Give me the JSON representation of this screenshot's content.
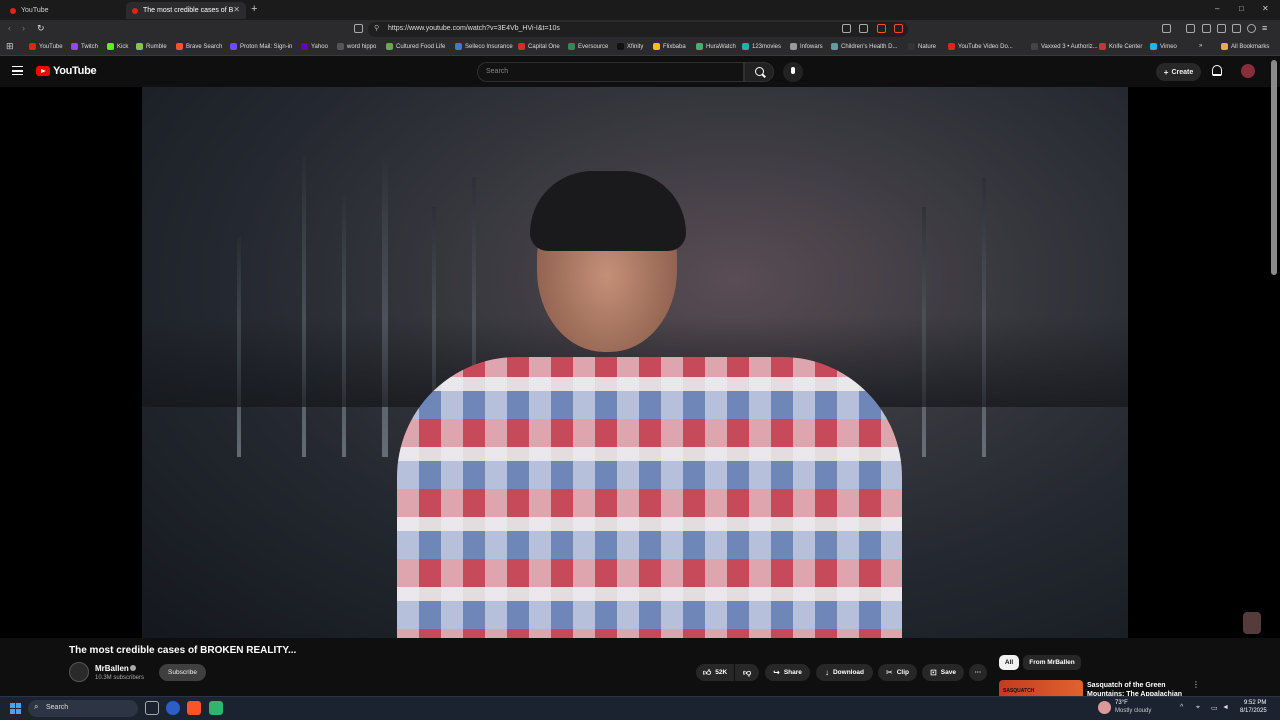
{
  "browser": {
    "tabs": [
      {
        "label": "YouTube",
        "active": false
      },
      {
        "label": "The most credible cases of B",
        "active": true
      }
    ],
    "new_tab": "+",
    "window_controls": [
      "–",
      "□",
      "✕"
    ],
    "url": "https://www.youtube.com/watch?v=3E4Vb_HVi-I&t=10s",
    "bookmarks": [
      {
        "label": "YouTube",
        "color": "#e62117"
      },
      {
        "label": "Twitch",
        "color": "#9146ff"
      },
      {
        "label": "Kick",
        "color": "#53fc18"
      },
      {
        "label": "Rumble",
        "color": "#85c742"
      },
      {
        "label": "Brave Search",
        "color": "#fb542b"
      },
      {
        "label": "Proton Mail: Sign-in",
        "color": "#6d4aff"
      },
      {
        "label": "Yahoo",
        "color": "#6001d2"
      },
      {
        "label": "word hippo",
        "color": "#555555"
      },
      {
        "label": "Cultured Food Life",
        "color": "#6aa84f"
      },
      {
        "label": "Selleco Insurance",
        "color": "#3a7bd5"
      },
      {
        "label": "Capital One",
        "color": "#d03027"
      },
      {
        "label": "Eversource",
        "color": "#2e8b57"
      },
      {
        "label": "Xfinity",
        "color": "#111111"
      },
      {
        "label": "Flixbaba",
        "color": "#f4c20d"
      },
      {
        "label": "HuraWatch",
        "color": "#3cb371"
      },
      {
        "label": "123movies",
        "color": "#20b2aa"
      },
      {
        "label": "Infowars",
        "color": "#999999"
      },
      {
        "label": "Children's Health D...",
        "color": "#5f9ea0"
      },
      {
        "label": "Nature",
        "color": "#333333"
      },
      {
        "label": "YouTube Video Do...",
        "color": "#e62117"
      },
      {
        "label": "Vaxxed 3 • Authoriz...",
        "color": "#444444"
      },
      {
        "label": "Knife Center",
        "color": "#cc3333"
      },
      {
        "label": "Vimeo",
        "color": "#1ab7ea"
      }
    ],
    "more_bookmarks": "»",
    "all_bookmarks": "All Bookmarks"
  },
  "masthead": {
    "logo_text": "YouTube",
    "search_placeholder": "Search",
    "create_label": "Create"
  },
  "video": {
    "title": "The most credible cases of BROKEN REALITY...",
    "channel_name": "MrBallen",
    "subscribers": "10.3M subscribers",
    "subscribe_label": "Subscribe",
    "likes": "52K",
    "share_label": "Share",
    "download_label": "Download",
    "clip_label": "Clip",
    "save_label": "Save",
    "more_label": "···"
  },
  "recommendations": {
    "chips": [
      "All",
      "From MrBallen"
    ],
    "first_title": "Sasquatch of the Green Mountains: The Appalachian",
    "first_thumb_text": "SASQUATCH",
    "more_label": "⋮"
  },
  "taskbar": {
    "search_label": "Search",
    "weather_temp": "73°F",
    "weather_desc": "Mostly cloudy",
    "time": "9:52 PM",
    "date": "8/17/2025"
  }
}
